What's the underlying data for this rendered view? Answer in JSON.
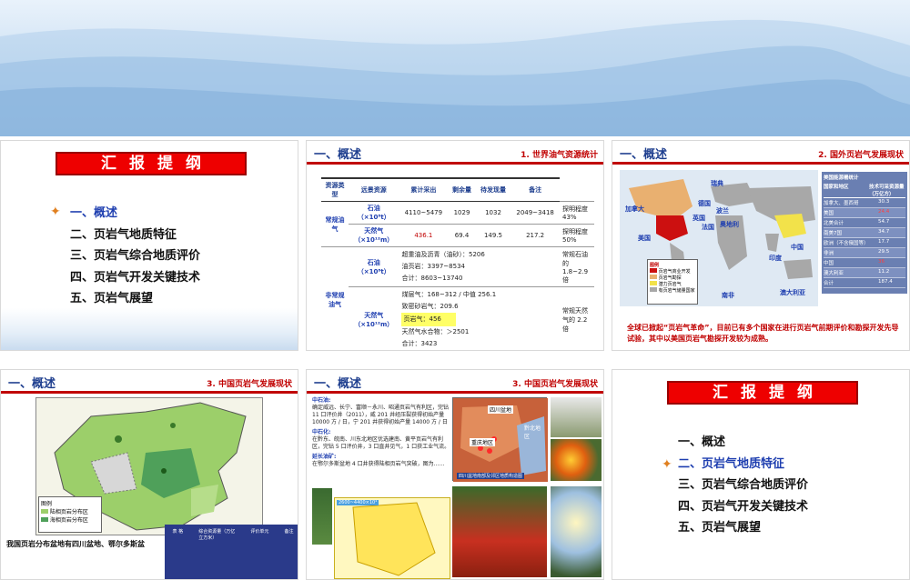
{
  "colors": {
    "accent_red": "#c00000",
    "title_blue": "#1f3f8f",
    "banner": "#cfe2f4"
  },
  "slide1": {
    "red_title": "汇报提纲",
    "items": [
      "一、概述",
      "二、页岩气地质特征",
      "三、页岩气综合地质评价",
      "四、页岩气开发关键技术",
      "五、页岩气展望"
    ],
    "active_index": 0
  },
  "slide2": {
    "title": "一、概述",
    "subtitle": "1. 世界油气资源统计",
    "headers": [
      "资源类型",
      "远景资源",
      "累计采出",
      "剩余量",
      "待发现量",
      "备注"
    ],
    "conv_label": "常规油气",
    "oil": {
      "name": "石油",
      "unit": "（×10⁸t）",
      "values": [
        "4110~5479",
        "1029",
        "1032",
        "2049~3418"
      ],
      "note": "探明程度43%"
    },
    "gas": {
      "name": "天然气",
      "unit": "（×10¹²m）",
      "values": [
        "436.1",
        "69.4",
        "149.5",
        "217.2"
      ],
      "note": "探明程度50%"
    },
    "unconv_label": "非常规油气",
    "uoil": {
      "name": "石油",
      "unit": "（×10⁸t）",
      "rows": [
        "超重油及沥青（油砂）：5206",
        "油页岩：3397~8534",
        "合计：8603~13740"
      ],
      "note": "常规石油的1.8~2.9 倍"
    },
    "ugas": {
      "name": "天然气",
      "unit": "（×10¹²m）",
      "rows": [
        "煤层气：168~312 / 中值 256.1",
        "致密砂岩气：209.6",
        "页岩气：456",
        "天然气水合物：＞2501",
        "合计：3423"
      ],
      "note": "常规天然气的 2.2 倍"
    }
  },
  "slide3": {
    "title": "一、概述",
    "subtitle": "2. 国外页岩气发展现状",
    "map_labels": [
      "瑞典",
      "加拿大",
      "德国",
      "波兰",
      "英国",
      "奥地利",
      "法国",
      "美国",
      "中国",
      "印度",
      "澳大利亚",
      "南非"
    ],
    "legend_title": "图例",
    "legend_items": [
      "页岩气商业开发",
      "页岩气勘探",
      "潜力页岩气",
      "有页岩气储量国家"
    ],
    "table_title": "美国能源署统计",
    "table_headers": [
      "国家和地区",
      "技术可采资源量（万亿方）"
    ],
    "table_rows": [
      [
        "加拿大、墨西哥",
        "30.3"
      ],
      [
        "美国",
        "24.4"
      ],
      [
        "北美合计",
        "54.7"
      ],
      [
        "南美7国",
        "34.7"
      ],
      [
        "欧洲（不含俄国等）",
        "17.7"
      ],
      [
        "非洲",
        "29.5"
      ],
      [
        "中国",
        "36"
      ],
      [
        "澳大利亚",
        "11.2"
      ],
      [
        "合计",
        "187.4"
      ]
    ],
    "caption": "全球已掀起“页岩气革命”，目前已有多个国家在进行页岩气前期评价和勘探开发先导试验，其中以美国页岩气勘探开发较为成熟。"
  },
  "slide4": {
    "title": "一、概述",
    "subtitle": "3. 中国页岩气发展现状",
    "legend_title": "图例",
    "legend_items": [
      "陆相页岩分布区",
      "海相页岩分布区"
    ],
    "caption": "我国页岩分布盆地有四川盆地、鄂尔多斯盆",
    "mini_headers": [
      "表 格",
      "综合资源量（万亿立方米）",
      "评价单元",
      "备注"
    ]
  },
  "slide5": {
    "title": "一、概述",
    "subtitle": "3. 中国页岩气发展现状",
    "sections": [
      {
        "head": "中石油:",
        "body": "确定威远、长宁、富顺－永川、昭通页岩气有利区，完钻 11 口评价井（2011），威 201 井经压裂获得初始产量 10000 方 / 日，宁 201 井获得初始产量 14000 方 / 日"
      },
      {
        "head": "中石化:",
        "body": "在黔东、皖南、川东北地区优选建南、黄平页岩气有利区，完钻 5 口评价井，3 口直井见气，1 口获工业气流。"
      },
      {
        "head": "延长油矿:",
        "body": "在鄂尔多斯盆地 4 口井获得陆相页岩气突破，图为……"
      }
    ],
    "map_labels": [
      "四川盆地",
      "黔北地区",
      "重庆地区"
    ],
    "map_caption": "四川盆地南部及邻区地质构造图",
    "strip_label": "2600~4400×10⁴"
  },
  "slide6": {
    "red_title": "汇报提纲",
    "items": [
      "一、概述",
      "二、页岩气地质特征",
      "三、页岩气综合地质评价",
      "四、页岩气开发关键技术",
      "五、页岩气展望"
    ],
    "active_index": 1
  }
}
